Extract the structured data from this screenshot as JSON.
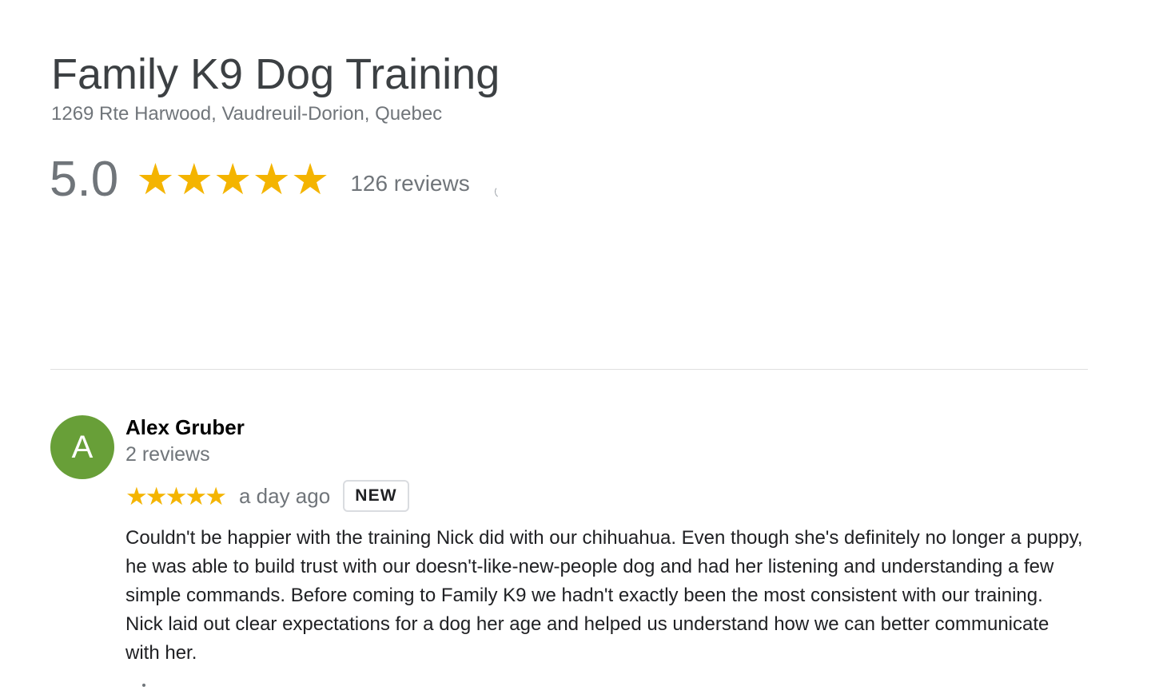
{
  "business": {
    "name": "Family K9 Dog Training",
    "address": "1269 Rte Harwood, Vaudreuil-Dorion, Quebec",
    "rating": "5.0",
    "stars": 5,
    "reviews_count": "126 reviews",
    "accent_star_color": "#f4b400"
  },
  "review": {
    "avatar_initial": "A",
    "avatar_color": "#689f38",
    "reviewer_name": "Alex Gruber",
    "reviewer_reviews": "2 reviews",
    "stars": 5,
    "time": "a day ago",
    "badge": "NEW",
    "text": "Couldn't be happier with the training Nick did with our chihuahua. Even though she's definitely no longer a puppy, he was able to build trust with our doesn't-like-new-people dog and had her listening and understanding a few simple commands. Before coming to Family K9 we hadn't exactly been the most consistent with our training. Nick laid out clear expectations for a dog her age and helped us understand how we can better communicate with her."
  },
  "icons": {
    "star": "star-icon",
    "loading": "loading-spinner-icon"
  }
}
